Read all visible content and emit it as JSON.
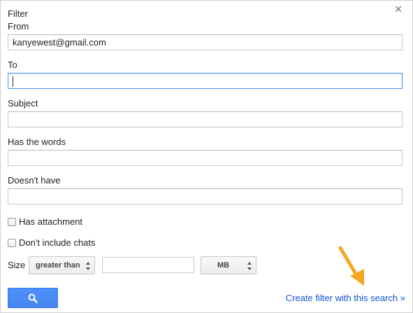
{
  "dialog": {
    "title": "Filter",
    "close_icon": "close-icon"
  },
  "fields": {
    "from": {
      "label": "From",
      "value": "kanyewest@gmail.com"
    },
    "to": {
      "label": "To",
      "value": ""
    },
    "subject": {
      "label": "Subject",
      "value": ""
    },
    "has_words": {
      "label": "Has the words",
      "value": ""
    },
    "doesnt_have": {
      "label": "Doesn't have",
      "value": ""
    }
  },
  "options": {
    "has_attachment": {
      "label": "Has attachment",
      "checked": false
    },
    "dont_include_chats": {
      "label": "Don't include chats",
      "checked": false
    }
  },
  "size": {
    "label": "Size",
    "comparator": "greater than",
    "amount": "",
    "unit": "MB"
  },
  "actions": {
    "search_icon": "search-icon",
    "create_filter_link": "Create filter with this search »"
  },
  "colors": {
    "accent_blue": "#4d90fe",
    "link_blue": "#1155cc",
    "annotation_orange": "#f5a623"
  }
}
